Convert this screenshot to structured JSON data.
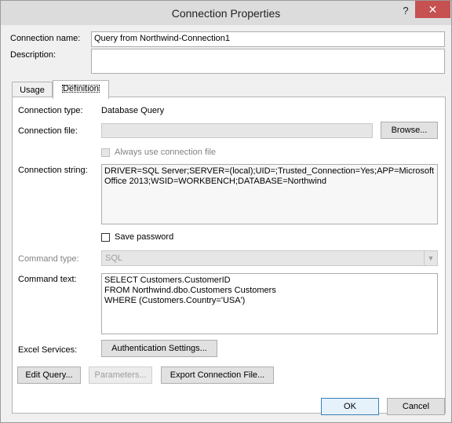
{
  "window": {
    "title": "Connection Properties",
    "help_glyph": "?",
    "close_glyph": "✕"
  },
  "connection_name": {
    "label": "Connection name:",
    "value": "Query from Northwind-Connection1"
  },
  "description": {
    "label": "Description:",
    "value": ""
  },
  "tabs": [
    {
      "label": "Usage"
    },
    {
      "label": "Definition"
    }
  ],
  "definition": {
    "connection_type": {
      "label": "Connection type:",
      "value": "Database Query"
    },
    "connection_file": {
      "label": "Connection file:",
      "value": "",
      "browse_label": "Browse..."
    },
    "always_use_file": {
      "label": "Always use connection file",
      "checked": false
    },
    "connection_string": {
      "label": "Connection string:",
      "value": "DRIVER=SQL Server;SERVER=(local);UID=;Trusted_Connection=Yes;APP=Microsoft Office 2013;WSID=WORKBENCH;DATABASE=Northwind"
    },
    "save_password": {
      "label": "Save password",
      "checked": false
    },
    "command_type": {
      "label": "Command type:",
      "value": "SQL"
    },
    "command_text": {
      "label": "Command text:",
      "value": "SELECT Customers.CustomerID\nFROM Northwind.dbo.Customers Customers\nWHERE (Customers.Country='USA')"
    },
    "excel_services": {
      "label": "Excel Services:",
      "button_label": "Authentication Settings..."
    },
    "edit_query_label": "Edit Query...",
    "parameters_label": "Parameters...",
    "export_label": "Export Connection File..."
  },
  "footer": {
    "ok_label": "OK",
    "cancel_label": "Cancel"
  }
}
